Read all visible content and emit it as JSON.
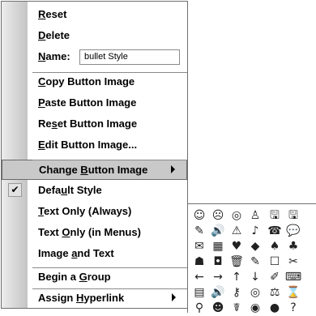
{
  "menu": {
    "items": [
      {
        "id": "reset",
        "pre": "",
        "u": "R",
        "post": "eset"
      },
      {
        "id": "delete",
        "pre": "",
        "u": "D",
        "post": "elete"
      },
      {
        "id": "name",
        "pre": "",
        "u": "N",
        "post": "ame:"
      },
      {
        "id": "copy-image",
        "pre": "",
        "u": "C",
        "post": "opy Button Image"
      },
      {
        "id": "paste-image",
        "pre": "",
        "u": "P",
        "post": "aste Button Image"
      },
      {
        "id": "reset-image",
        "pre": "Re",
        "u": "s",
        "post": "et Button Image"
      },
      {
        "id": "edit-image",
        "pre": "",
        "u": "E",
        "post": "dit Button Image..."
      },
      {
        "id": "change-image",
        "pre": "Change ",
        "u": "B",
        "post": "utton Image"
      },
      {
        "id": "default-style",
        "pre": "Defa",
        "u": "u",
        "post": "lt Style"
      },
      {
        "id": "text-always",
        "pre": "",
        "u": "T",
        "post": "ext Only (Always)"
      },
      {
        "id": "text-menus",
        "pre": "Text ",
        "u": "O",
        "post": "nly (in Menus)"
      },
      {
        "id": "image-text",
        "pre": "Image ",
        "u": "a",
        "post": "nd Text"
      },
      {
        "id": "begin-group",
        "pre": "Begin a ",
        "u": "G",
        "post": "roup"
      },
      {
        "id": "hyperlink",
        "pre": "Assign ",
        "u": "H",
        "post": "yperlink"
      }
    ],
    "name_value": "bullet Style",
    "checked_mark": "✔"
  },
  "palette": {
    "rows": [
      [
        "☺",
        "☹",
        "◎",
        "♙",
        "🖫",
        "🖫"
      ],
      [
        "✎",
        "🔊",
        "⚠",
        "♪",
        "☎",
        "💬"
      ],
      [
        "✉",
        "▦",
        "♥",
        "◆",
        "♠",
        "♣"
      ],
      [
        "☗",
        "◘",
        "🗑",
        "✎",
        "☐",
        "✂"
      ],
      [
        "←",
        "→",
        "↑",
        "↓",
        "✐",
        "⌨"
      ],
      [
        "▤",
        "🔊",
        "⚷",
        "◎",
        "⚖",
        "⌛"
      ],
      [
        "⚲",
        "☻",
        "☤",
        "◉",
        "●",
        "?"
      ]
    ]
  }
}
